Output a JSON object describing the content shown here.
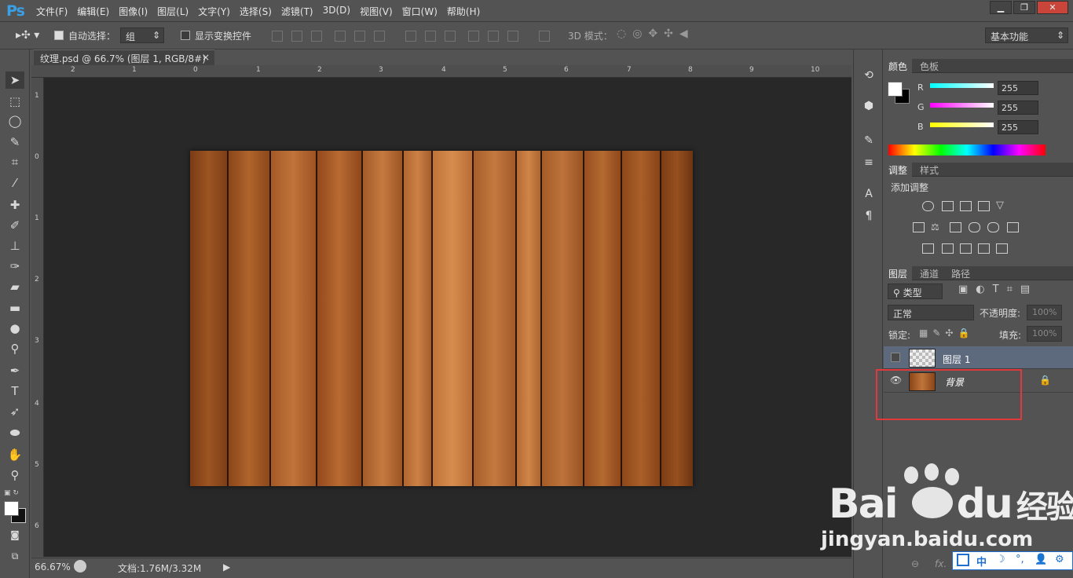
{
  "app": {
    "logo": "Ps",
    "window_buttons": [
      "▁",
      "❐",
      "✕"
    ]
  },
  "menu": [
    "文件(F)",
    "编辑(E)",
    "图像(I)",
    "图层(L)",
    "文字(Y)",
    "选择(S)",
    "滤镜(T)",
    "3D(D)",
    "视图(V)",
    "窗口(W)",
    "帮助(H)"
  ],
  "options": {
    "auto_select_label": "自动选择：",
    "auto_select_value": "组",
    "transform_label": "显示变换控件",
    "mode3d_label": "3D 模式：",
    "workspace": "基本功能"
  },
  "document": {
    "tab_title": "纹理.psd @ 66.7% (图层 1, RGB/8#) *",
    "zoom": "66.67%",
    "doc_info": "文档:1.76M/3.32M"
  },
  "rulers": {
    "h": [
      "2",
      "1",
      "0",
      "1",
      "2",
      "3",
      "4",
      "5",
      "6",
      "7",
      "8",
      "9",
      "10"
    ],
    "v": [
      "1",
      "0",
      "1",
      "2",
      "3",
      "4",
      "5",
      "6"
    ]
  },
  "color_panel": {
    "tabs": [
      "颜色",
      "色板"
    ],
    "channels": [
      {
        "label": "R",
        "value": "255"
      },
      {
        "label": "G",
        "value": "255"
      },
      {
        "label": "B",
        "value": "255"
      }
    ]
  },
  "adjust_panel": {
    "tabs": [
      "调整",
      "样式"
    ],
    "title": "添加调整"
  },
  "layers_panel": {
    "tabs": [
      "图层",
      "通道",
      "路径"
    ],
    "filter": "类型",
    "blend_mode": "正常",
    "opacity_label": "不透明度:",
    "opacity_value": "100%",
    "lock_label": "锁定:",
    "fill_label": "填充:",
    "fill_value": "100%",
    "layers": [
      {
        "name": "图层 1",
        "visible": false,
        "selected": true
      },
      {
        "name": "背景",
        "visible": true,
        "selected": false,
        "locked": true
      }
    ],
    "footer": [
      "⊖",
      "fx."
    ]
  },
  "watermark": {
    "brand": "Bai",
    "brand2": "du",
    "suffix": "经验",
    "url": "jingyan.baidu.com"
  },
  "ime_bar": {
    "items": [
      "中",
      "☽",
      "°,",
      "👤",
      "⚙"
    ]
  }
}
